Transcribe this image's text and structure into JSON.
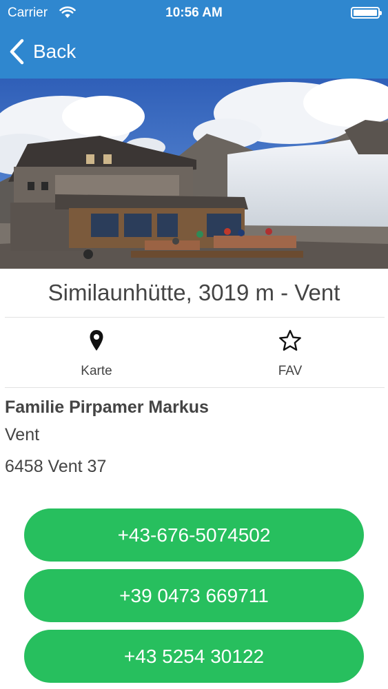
{
  "status_bar": {
    "carrier": "Carrier",
    "time": "10:56 AM"
  },
  "nav": {
    "back_label": "Back"
  },
  "hut": {
    "title": "Similaunhütte, 3019 m - Vent"
  },
  "actions": [
    {
      "label": "Karte",
      "icon": "map-pin-icon"
    },
    {
      "label": "FAV",
      "icon": "star-icon"
    }
  ],
  "address": {
    "name": "Familie Pirpamer Markus",
    "line1": "Vent",
    "line2": "6458 Vent 37"
  },
  "phones": [
    "+43-676-5074502",
    "+39 0473 669711",
    "+43 5254 30122"
  ],
  "colors": {
    "header_blue": "#2f87cf",
    "button_green": "#27bf5e"
  }
}
